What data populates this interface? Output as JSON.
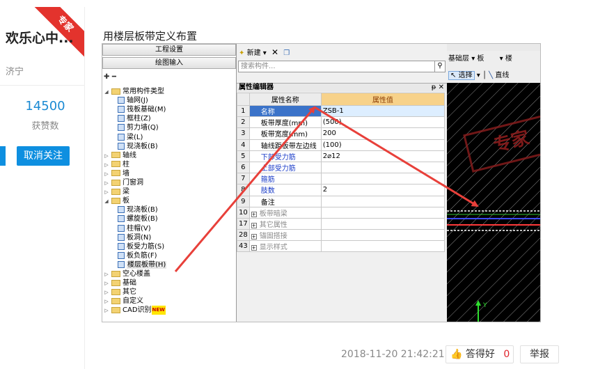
{
  "profile": {
    "badge": "专家",
    "username": "欢乐心中...",
    "city": "济宁",
    "likes_count": "14500",
    "likes_label": "获赞数",
    "unfollow_label": "取消关注"
  },
  "post": {
    "title": "用楼层板带定义布置",
    "date": "2018-11-20 21:42:21",
    "good_answer_label": "答得好",
    "good_answer_count": "0",
    "report_label": "举报"
  },
  "software": {
    "left_buttons": [
      "工程设置",
      "绘图输入"
    ],
    "tree": [
      {
        "label": "常用构件类型",
        "level": 0,
        "type": "folder",
        "expanded": true
      },
      {
        "label": "轴网(J)",
        "level": 1,
        "type": "item"
      },
      {
        "label": "筏板基础(M)",
        "level": 1,
        "type": "item"
      },
      {
        "label": "框柱(Z)",
        "level": 1,
        "type": "item"
      },
      {
        "label": "剪力墙(Q)",
        "level": 1,
        "type": "item"
      },
      {
        "label": "梁(L)",
        "level": 1,
        "type": "item"
      },
      {
        "label": "现浇板(B)",
        "level": 1,
        "type": "item"
      },
      {
        "label": "轴线",
        "level": 0,
        "type": "folder"
      },
      {
        "label": "柱",
        "level": 0,
        "type": "folder"
      },
      {
        "label": "墙",
        "level": 0,
        "type": "folder"
      },
      {
        "label": "门窗洞",
        "level": 0,
        "type": "folder"
      },
      {
        "label": "梁",
        "level": 0,
        "type": "folder"
      },
      {
        "label": "板",
        "level": 0,
        "type": "folder",
        "expanded": true
      },
      {
        "label": "现浇板(B)",
        "level": 1,
        "type": "item"
      },
      {
        "label": "螺旋板(B)",
        "level": 1,
        "type": "item"
      },
      {
        "label": "柱帽(V)",
        "level": 1,
        "type": "item"
      },
      {
        "label": "板洞(N)",
        "level": 1,
        "type": "item"
      },
      {
        "label": "板受力筋(S)",
        "level": 1,
        "type": "item"
      },
      {
        "label": "板负筋(F)",
        "level": 1,
        "type": "item"
      },
      {
        "label": "楼层板带(H)",
        "level": 1,
        "type": "item",
        "selected": true
      },
      {
        "label": "空心楼盖",
        "level": 0,
        "type": "folder"
      },
      {
        "label": "基础",
        "level": 0,
        "type": "folder"
      },
      {
        "label": "其它",
        "level": 0,
        "type": "folder"
      },
      {
        "label": "自定义",
        "level": 0,
        "type": "folder"
      },
      {
        "label": "CAD识别",
        "level": 0,
        "type": "folder",
        "new": "NEW"
      }
    ],
    "middle_toolbar": {
      "new_label": "新建"
    },
    "search_placeholder": "搜索构件...",
    "prop_panel_title": "属性编辑器",
    "prop_columns": [
      "属性名称",
      "属性值"
    ],
    "props": [
      {
        "num": "1",
        "name": "名称",
        "value": "ZSB-1",
        "style": "blue",
        "selected": true
      },
      {
        "num": "2",
        "name": "板带厚度(mm)",
        "value": "(500)",
        "style": "normal"
      },
      {
        "num": "3",
        "name": "板带宽度(mm)",
        "value": "200",
        "style": "normal"
      },
      {
        "num": "4",
        "name": "轴线距板带左边线",
        "value": "(100)",
        "style": "normal"
      },
      {
        "num": "5",
        "name": "下部受力筋",
        "value": "2⌀12",
        "style": "blue"
      },
      {
        "num": "6",
        "name": "上部受力筋",
        "value": "",
        "style": "blue"
      },
      {
        "num": "7",
        "name": "箍筋",
        "value": "",
        "style": "blue"
      },
      {
        "num": "8",
        "name": "肢数",
        "value": "2",
        "style": "blue"
      },
      {
        "num": "9",
        "name": "备注",
        "value": "",
        "style": "normal"
      },
      {
        "num": "10",
        "name": "板带暗梁",
        "value": "",
        "style": "gray",
        "group": true
      },
      {
        "num": "17",
        "name": "其它属性",
        "value": "",
        "style": "gray",
        "group": true
      },
      {
        "num": "28",
        "name": "锚固搭接",
        "value": "",
        "style": "gray",
        "group": true
      },
      {
        "num": "43",
        "name": "显示样式",
        "value": "",
        "style": "gray",
        "group": true
      }
    ],
    "right_toolbar": {
      "layer_label": "基础层",
      "type_label": "板",
      "type2_label": "楼",
      "select_label": "选择",
      "line_label": "直线"
    },
    "canvas_watermark": "专家"
  },
  "colors": {
    "accent": "#0e8fe0",
    "ribbon": "#e3332d",
    "arrow": "#e8403a",
    "likes": "#1a8ad3"
  }
}
